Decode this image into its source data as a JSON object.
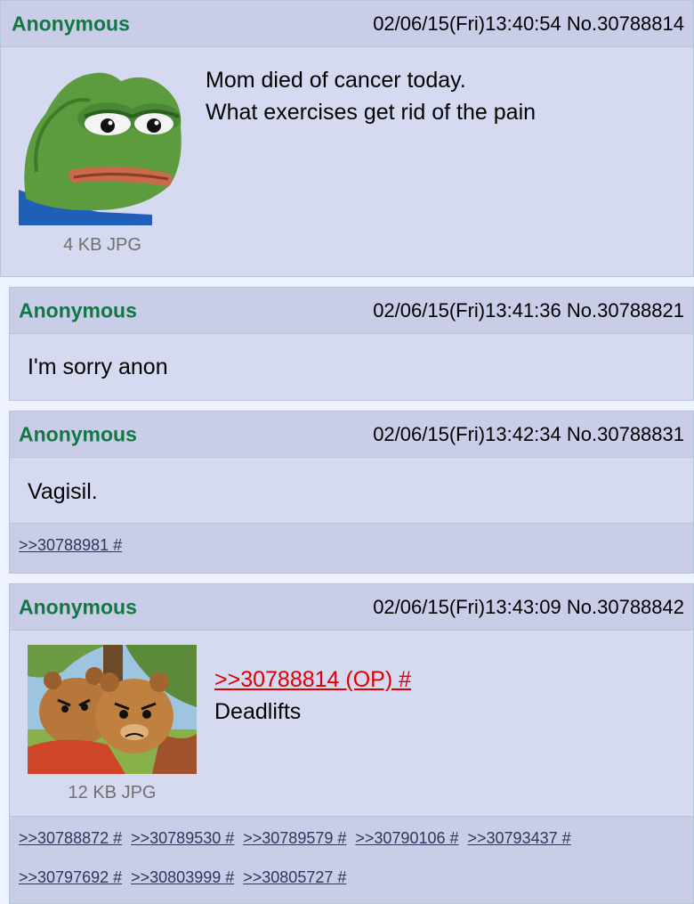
{
  "posts": [
    {
      "name": "Anonymous",
      "meta": "02/06/15(Fri)13:40:54 No.30788814",
      "lines": [
        "Mom died of cancer today.",
        "What exercises get rid of the pain"
      ],
      "file_info": "4 KB JPG"
    },
    {
      "name": "Anonymous",
      "meta": "02/06/15(Fri)13:41:36 No.30788821",
      "lines": [
        "I'm sorry anon"
      ]
    },
    {
      "name": "Anonymous",
      "meta": "02/06/15(Fri)13:42:34 No.30788831",
      "lines": [
        "Vagisil."
      ],
      "backlinks": [
        ">>30788981 #"
      ]
    },
    {
      "name": "Anonymous",
      "meta": "02/06/15(Fri)13:43:09 No.30788842",
      "quote": ">>30788814 (OP) #",
      "lines": [
        "Deadlifts"
      ],
      "file_info": "12 KB JPG",
      "backlinks": [
        ">>30788872 #",
        ">>30789530 #",
        ">>30789579 #",
        ">>30790106 #",
        ">>30793437 #",
        ">>30797692 #",
        ">>30803999 #",
        ">>30805727 #"
      ]
    }
  ],
  "colors": {
    "name": "#117743",
    "post_bg": "#d6daf0",
    "header_bg": "#c9cde8",
    "border": "#b7c5d9",
    "backlink": "#34345c",
    "quote_link": "#dd0000",
    "page_bg": "#eef2ff"
  },
  "icons": [
    "sad-frog-thumbnail",
    "angry-bears-thumbnail"
  ]
}
